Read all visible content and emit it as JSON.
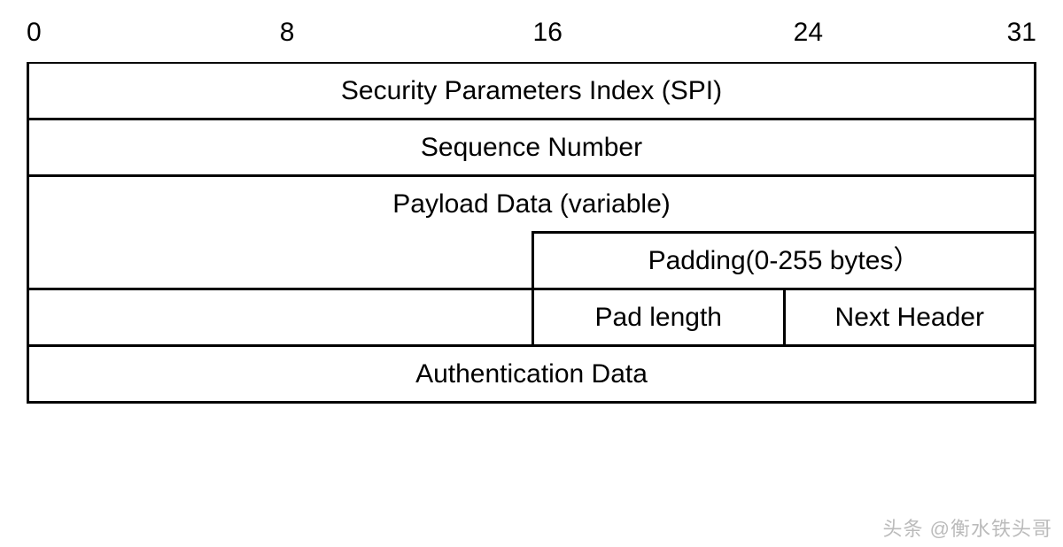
{
  "ruler": {
    "ticks": [
      "0",
      "8",
      "16",
      "24",
      "31"
    ]
  },
  "rows": {
    "spi": "Security Parameters Index (SPI)",
    "seq": "Sequence Number",
    "payload": "Payload Data (variable)",
    "padding": "Padding(0-255 bytes）",
    "pad_length": "Pad length",
    "next_header": "Next Header",
    "auth": "Authentication Data"
  },
  "watermark": "头条 @衡水铁头哥"
}
